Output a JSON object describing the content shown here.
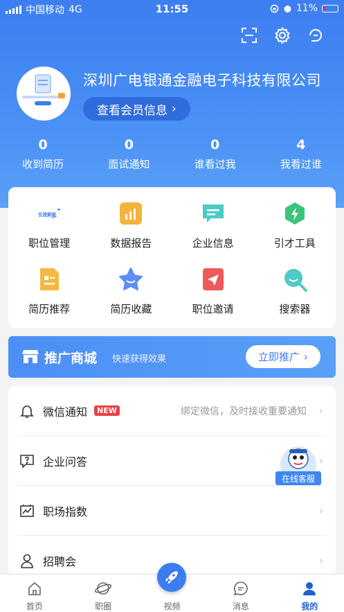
{
  "status_bar": {
    "carrier": "中国移动",
    "network": "4G",
    "time": "11:55",
    "battery": "11%"
  },
  "profile": {
    "company_name": "深圳广电银通金融电子科技有限公司",
    "member_button": "查看会员信息"
  },
  "stats": [
    {
      "value": "0",
      "label": "收到简历"
    },
    {
      "value": "0",
      "label": "面试通知"
    },
    {
      "value": "0",
      "label": "谁看过我"
    },
    {
      "value": "4",
      "label": "我看过谁"
    }
  ],
  "tools": [
    {
      "label": "职位管理",
      "icon": "refresh-badge-icon",
      "badge": "长按刷新",
      "color": "#3b7df0"
    },
    {
      "label": "数据报告",
      "icon": "bar-chart-icon",
      "color": "#f3b33d"
    },
    {
      "label": "企业信息",
      "icon": "message-icon",
      "color": "#4ecbc4"
    },
    {
      "label": "引才工具",
      "icon": "lightning-icon",
      "color": "#3cc47c"
    },
    {
      "label": "简历推荐",
      "icon": "resume-icon",
      "color": "#f5b840"
    },
    {
      "label": "简历收藏",
      "icon": "star-icon",
      "color": "#5b8ff5"
    },
    {
      "label": "职位邀请",
      "icon": "send-icon",
      "color": "#ee5a5a"
    },
    {
      "label": "搜索器",
      "icon": "search-icon",
      "color": "#4ecbc4"
    }
  ],
  "promo": {
    "title": "推广商城",
    "subtitle": "快速获得效果",
    "button": "立即推广"
  },
  "menu": [
    {
      "label": "微信通知",
      "badge": "NEW",
      "hint": "绑定微信，及时接收重要通知",
      "icon": "bell-icon"
    },
    {
      "label": "企业问答",
      "icon": "question-icon"
    },
    {
      "label": "职场指数",
      "icon": "chart-icon"
    },
    {
      "label": "招聘会",
      "icon": "person-icon"
    }
  ],
  "service": {
    "label": "在线客服"
  },
  "tabs": [
    {
      "label": "首页",
      "icon": "home-icon"
    },
    {
      "label": "职圈",
      "icon": "planet-icon"
    },
    {
      "label": "视频",
      "icon": "rocket-icon"
    },
    {
      "label": "消息",
      "icon": "chat-icon"
    },
    {
      "label": "我的",
      "icon": "user-icon",
      "active": true
    }
  ],
  "colors": {
    "primary": "#3b7df0",
    "badge_red": "#e94141",
    "active_tab": "#1f5fd6"
  }
}
